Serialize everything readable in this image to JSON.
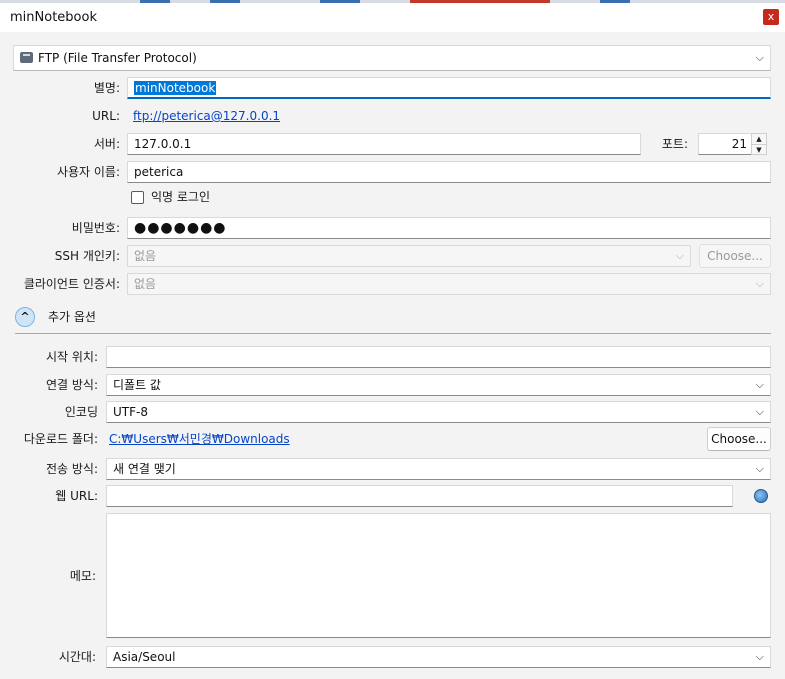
{
  "window": {
    "title": "minNotebook",
    "close_glyph": "x"
  },
  "protocol": {
    "value": "FTP (File Transfer Protocol)",
    "icon": "ftp-drive-icon"
  },
  "labels": {
    "nickname": "별명:",
    "url": "URL:",
    "server": "서버:",
    "port": "포트:",
    "username": "사용자 이름:",
    "anonymous": "익명 로그인",
    "password": "비밀번호:",
    "ssh_key": "SSH 개인키:",
    "client_cert": "클라이언트 인증서:",
    "more_options": "추가 옵션",
    "start_path": "시작 위치:",
    "connect_mode": "연결 방식:",
    "encoding": "인코딩",
    "download_folder": "다운로드 폴더:",
    "transfer_mode": "전송 방식:",
    "web_url": "웹 URL:",
    "memo": "메모:",
    "timezone": "시간대:"
  },
  "values": {
    "nickname": "minNotebook",
    "url": "ftp://peterica@127.0.0.1",
    "server": "127.0.0.1",
    "port": "21",
    "username": "peterica",
    "anonymous_checked": false,
    "password_mask": "●●●●●●●",
    "ssh_key": "없음",
    "client_cert": "없음",
    "start_path": "",
    "connect_mode": "디폴트 값",
    "encoding": "UTF-8",
    "download_folder": "C:₩Users₩서민경₩Downloads",
    "transfer_mode": "새 연결 맺기",
    "web_url": "",
    "memo": "",
    "timezone": "Asia/Seoul"
  },
  "buttons": {
    "ssh_choose": "Choose...",
    "download_choose": "Choose..."
  },
  "icons": {
    "dropdown": "chevron-down-icon",
    "expander": "chevron-up-icon",
    "web": "globe-icon"
  },
  "colors": {
    "accent": "#0067c0",
    "selection": "#0078d7",
    "link": "#0645c8",
    "close": "#c42b1c"
  }
}
